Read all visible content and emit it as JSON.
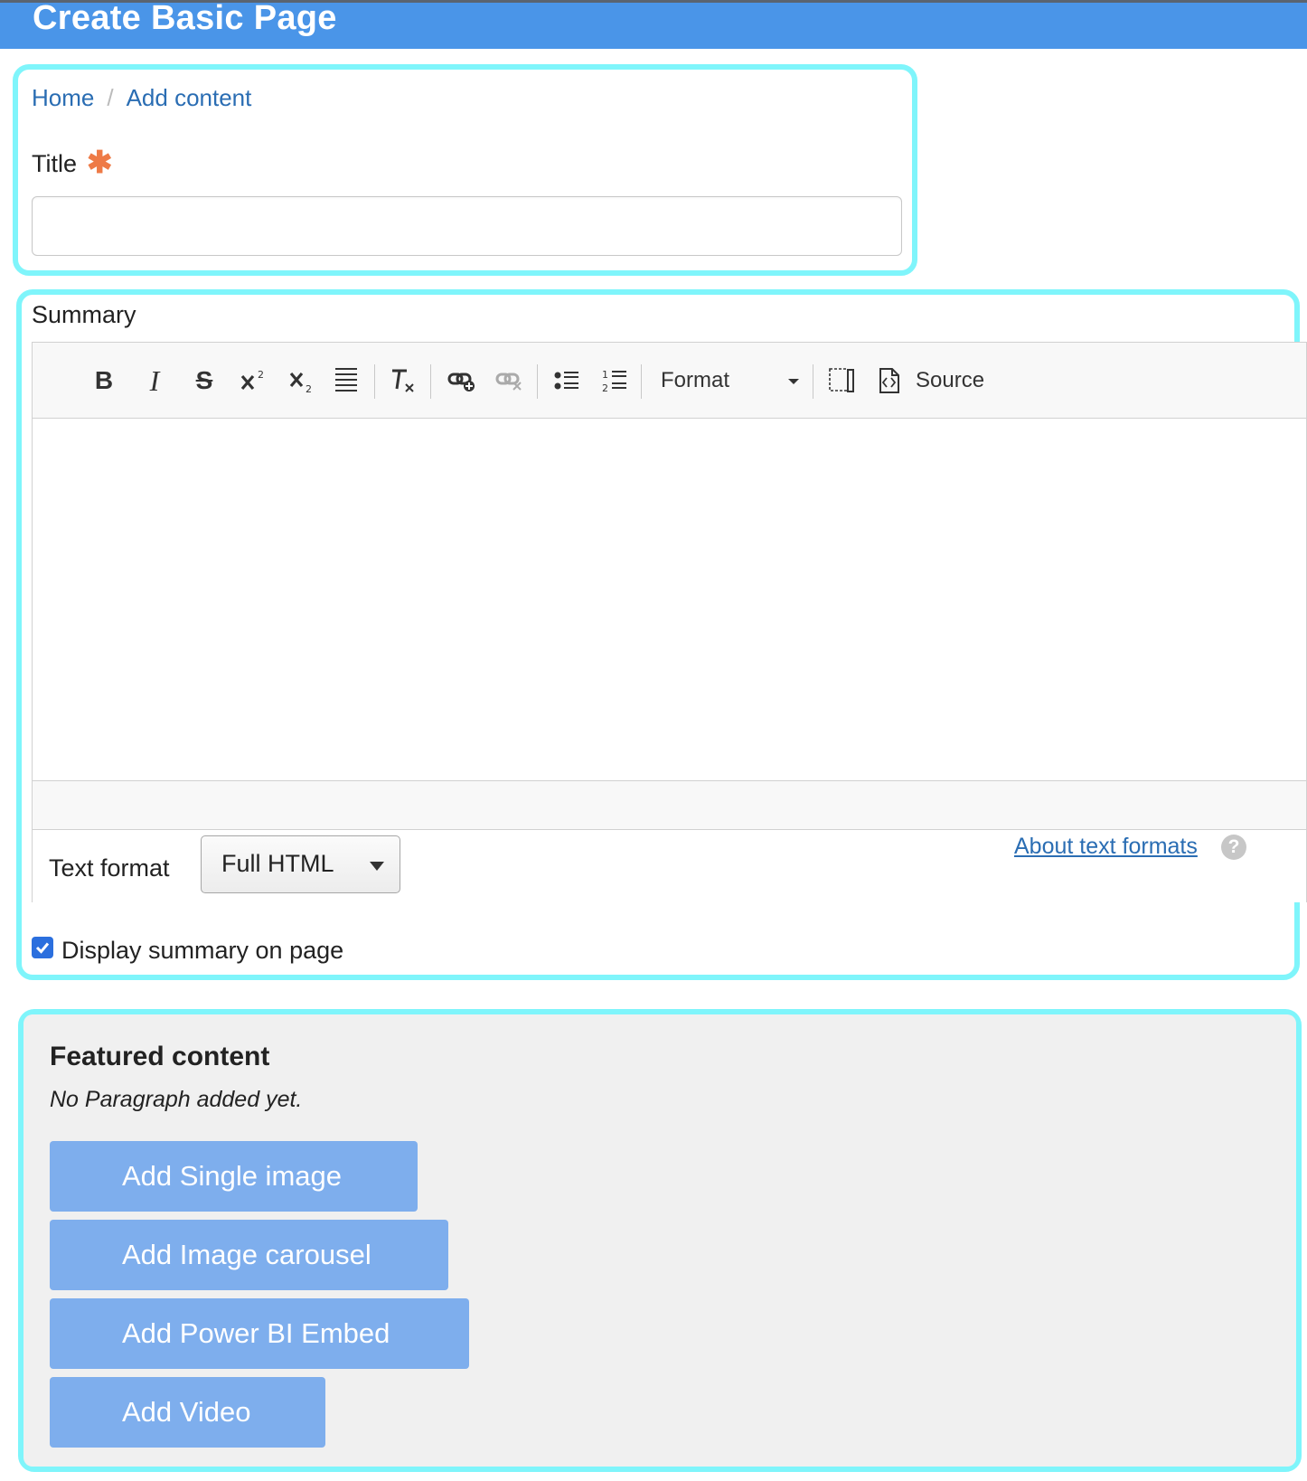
{
  "header": {
    "title": "Create Basic Page"
  },
  "breadcrumb": {
    "home": "Home",
    "separator": "/",
    "current": "Add content"
  },
  "title_field": {
    "label": "Title",
    "required_mark": "✱",
    "value": ""
  },
  "summary": {
    "label": "Summary",
    "toolbar": {
      "bold": "B",
      "italic": "I",
      "strike": "S",
      "format_label": "Format",
      "source_label": "Source"
    },
    "text_format_label": "Text format",
    "text_format_value": "Full HTML",
    "about_link": "About text formats",
    "help_icon": "?",
    "display_summary_label": "Display summary on page",
    "display_summary_checked": true
  },
  "featured": {
    "title": "Featured content",
    "empty_text": "No Paragraph added yet.",
    "buttons": [
      "Add Single image",
      "Add Image carousel",
      "Add Power BI Embed",
      "Add Video"
    ]
  },
  "colors": {
    "header_bg": "#4a95e8",
    "highlight": "#7ff5fb",
    "link": "#2a6db3",
    "required": "#ee7a46",
    "add_button": "#7eaeed"
  }
}
